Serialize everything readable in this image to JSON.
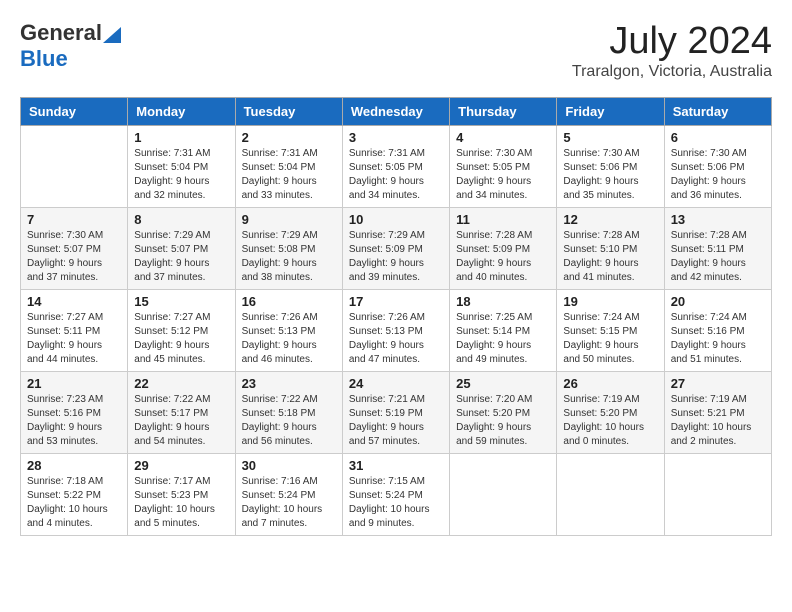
{
  "logo": {
    "general": "General",
    "blue": "Blue"
  },
  "title": {
    "month_year": "July 2024",
    "location": "Traralgon, Victoria, Australia"
  },
  "headers": [
    "Sunday",
    "Monday",
    "Tuesday",
    "Wednesday",
    "Thursday",
    "Friday",
    "Saturday"
  ],
  "weeks": [
    [
      {
        "day": "",
        "sunrise": "",
        "sunset": "",
        "daylight": ""
      },
      {
        "day": "1",
        "sunrise": "Sunrise: 7:31 AM",
        "sunset": "Sunset: 5:04 PM",
        "daylight": "Daylight: 9 hours and 32 minutes."
      },
      {
        "day": "2",
        "sunrise": "Sunrise: 7:31 AM",
        "sunset": "Sunset: 5:04 PM",
        "daylight": "Daylight: 9 hours and 33 minutes."
      },
      {
        "day": "3",
        "sunrise": "Sunrise: 7:31 AM",
        "sunset": "Sunset: 5:05 PM",
        "daylight": "Daylight: 9 hours and 34 minutes."
      },
      {
        "day": "4",
        "sunrise": "Sunrise: 7:30 AM",
        "sunset": "Sunset: 5:05 PM",
        "daylight": "Daylight: 9 hours and 34 minutes."
      },
      {
        "day": "5",
        "sunrise": "Sunrise: 7:30 AM",
        "sunset": "Sunset: 5:06 PM",
        "daylight": "Daylight: 9 hours and 35 minutes."
      },
      {
        "day": "6",
        "sunrise": "Sunrise: 7:30 AM",
        "sunset": "Sunset: 5:06 PM",
        "daylight": "Daylight: 9 hours and 36 minutes."
      }
    ],
    [
      {
        "day": "7",
        "sunrise": "Sunrise: 7:30 AM",
        "sunset": "Sunset: 5:07 PM",
        "daylight": "Daylight: 9 hours and 37 minutes."
      },
      {
        "day": "8",
        "sunrise": "Sunrise: 7:29 AM",
        "sunset": "Sunset: 5:07 PM",
        "daylight": "Daylight: 9 hours and 37 minutes."
      },
      {
        "day": "9",
        "sunrise": "Sunrise: 7:29 AM",
        "sunset": "Sunset: 5:08 PM",
        "daylight": "Daylight: 9 hours and 38 minutes."
      },
      {
        "day": "10",
        "sunrise": "Sunrise: 7:29 AM",
        "sunset": "Sunset: 5:09 PM",
        "daylight": "Daylight: 9 hours and 39 minutes."
      },
      {
        "day": "11",
        "sunrise": "Sunrise: 7:28 AM",
        "sunset": "Sunset: 5:09 PM",
        "daylight": "Daylight: 9 hours and 40 minutes."
      },
      {
        "day": "12",
        "sunrise": "Sunrise: 7:28 AM",
        "sunset": "Sunset: 5:10 PM",
        "daylight": "Daylight: 9 hours and 41 minutes."
      },
      {
        "day": "13",
        "sunrise": "Sunrise: 7:28 AM",
        "sunset": "Sunset: 5:11 PM",
        "daylight": "Daylight: 9 hours and 42 minutes."
      }
    ],
    [
      {
        "day": "14",
        "sunrise": "Sunrise: 7:27 AM",
        "sunset": "Sunset: 5:11 PM",
        "daylight": "Daylight: 9 hours and 44 minutes."
      },
      {
        "day": "15",
        "sunrise": "Sunrise: 7:27 AM",
        "sunset": "Sunset: 5:12 PM",
        "daylight": "Daylight: 9 hours and 45 minutes."
      },
      {
        "day": "16",
        "sunrise": "Sunrise: 7:26 AM",
        "sunset": "Sunset: 5:13 PM",
        "daylight": "Daylight: 9 hours and 46 minutes."
      },
      {
        "day": "17",
        "sunrise": "Sunrise: 7:26 AM",
        "sunset": "Sunset: 5:13 PM",
        "daylight": "Daylight: 9 hours and 47 minutes."
      },
      {
        "day": "18",
        "sunrise": "Sunrise: 7:25 AM",
        "sunset": "Sunset: 5:14 PM",
        "daylight": "Daylight: 9 hours and 49 minutes."
      },
      {
        "day": "19",
        "sunrise": "Sunrise: 7:24 AM",
        "sunset": "Sunset: 5:15 PM",
        "daylight": "Daylight: 9 hours and 50 minutes."
      },
      {
        "day": "20",
        "sunrise": "Sunrise: 7:24 AM",
        "sunset": "Sunset: 5:16 PM",
        "daylight": "Daylight: 9 hours and 51 minutes."
      }
    ],
    [
      {
        "day": "21",
        "sunrise": "Sunrise: 7:23 AM",
        "sunset": "Sunset: 5:16 PM",
        "daylight": "Daylight: 9 hours and 53 minutes."
      },
      {
        "day": "22",
        "sunrise": "Sunrise: 7:22 AM",
        "sunset": "Sunset: 5:17 PM",
        "daylight": "Daylight: 9 hours and 54 minutes."
      },
      {
        "day": "23",
        "sunrise": "Sunrise: 7:22 AM",
        "sunset": "Sunset: 5:18 PM",
        "daylight": "Daylight: 9 hours and 56 minutes."
      },
      {
        "day": "24",
        "sunrise": "Sunrise: 7:21 AM",
        "sunset": "Sunset: 5:19 PM",
        "daylight": "Daylight: 9 hours and 57 minutes."
      },
      {
        "day": "25",
        "sunrise": "Sunrise: 7:20 AM",
        "sunset": "Sunset: 5:20 PM",
        "daylight": "Daylight: 9 hours and 59 minutes."
      },
      {
        "day": "26",
        "sunrise": "Sunrise: 7:19 AM",
        "sunset": "Sunset: 5:20 PM",
        "daylight": "Daylight: 10 hours and 0 minutes."
      },
      {
        "day": "27",
        "sunrise": "Sunrise: 7:19 AM",
        "sunset": "Sunset: 5:21 PM",
        "daylight": "Daylight: 10 hours and 2 minutes."
      }
    ],
    [
      {
        "day": "28",
        "sunrise": "Sunrise: 7:18 AM",
        "sunset": "Sunset: 5:22 PM",
        "daylight": "Daylight: 10 hours and 4 minutes."
      },
      {
        "day": "29",
        "sunrise": "Sunrise: 7:17 AM",
        "sunset": "Sunset: 5:23 PM",
        "daylight": "Daylight: 10 hours and 5 minutes."
      },
      {
        "day": "30",
        "sunrise": "Sunrise: 7:16 AM",
        "sunset": "Sunset: 5:24 PM",
        "daylight": "Daylight: 10 hours and 7 minutes."
      },
      {
        "day": "31",
        "sunrise": "Sunrise: 7:15 AM",
        "sunset": "Sunset: 5:24 PM",
        "daylight": "Daylight: 10 hours and 9 minutes."
      },
      {
        "day": "",
        "sunrise": "",
        "sunset": "",
        "daylight": ""
      },
      {
        "day": "",
        "sunrise": "",
        "sunset": "",
        "daylight": ""
      },
      {
        "day": "",
        "sunrise": "",
        "sunset": "",
        "daylight": ""
      }
    ]
  ]
}
